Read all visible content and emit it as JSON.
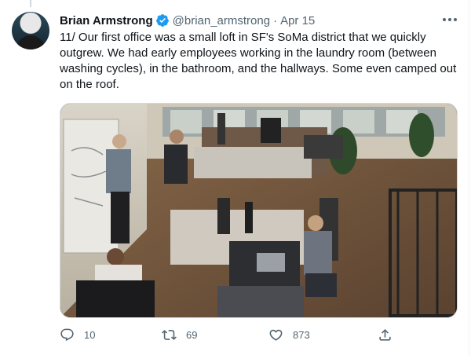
{
  "tweet": {
    "author_name": "Brian Armstrong",
    "handle": "@brian_armstrong",
    "separator": "·",
    "date": "Apr 15",
    "text": "11/ Our first office was a small loft in SF's SoMa district that we quickly outgrew. We had early employees working in the laundry room (between washing cycles), in the bathroom, and the hallways. Some even camped out on the roof.",
    "verified": true
  },
  "actions": {
    "reply_count": "10",
    "retweet_count": "69",
    "like_count": "873"
  },
  "icons": {
    "verified": "verified-badge-icon",
    "more": "more-horizontal-icon",
    "reply": "reply-icon",
    "retweet": "retweet-icon",
    "like": "heart-icon",
    "share": "share-icon"
  },
  "colors": {
    "accent": "#1d9bf0",
    "secondary_text": "#536471",
    "primary_text": "#0f1419"
  }
}
